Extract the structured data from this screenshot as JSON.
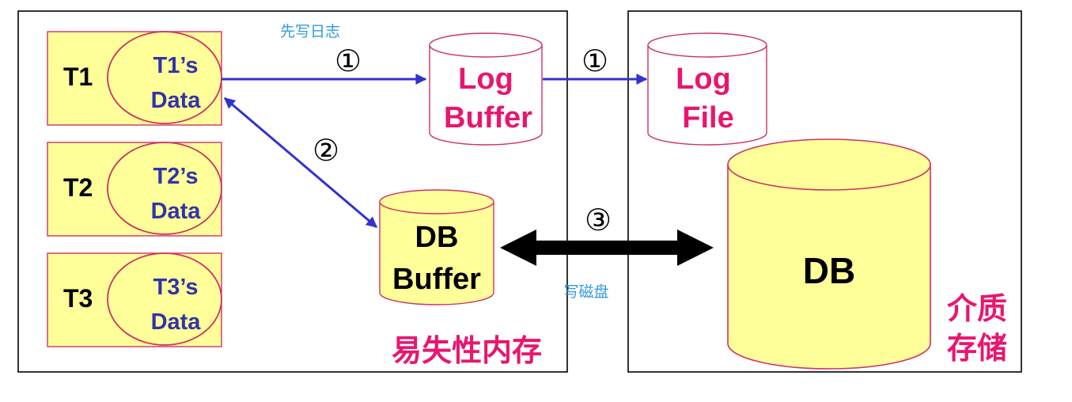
{
  "colors": {
    "background": "#ffffff",
    "frame": "#000000",
    "txn_fill": "#ffff99",
    "txn_border": "#cc3366",
    "data_text": "#3333aa",
    "cylinder_border": "#cc3366",
    "log_text": "#e8166f",
    "db_fill": "#ffff99",
    "arrow_blue": "#3333cc",
    "arrow_black": "#000000",
    "annotation_blue": "#3399dd",
    "region_label": "#e8166f",
    "dark_text": "#000000"
  },
  "volatile_memory": {
    "label": "易失性内存",
    "transactions": [
      {
        "name": "T1",
        "data_line1": "T1’s",
        "data_line2": "Data"
      },
      {
        "name": "T2",
        "data_line1": "T2’s",
        "data_line2": "Data"
      },
      {
        "name": "T3",
        "data_line1": "T3’s",
        "data_line2": "Data"
      }
    ],
    "log_buffer": {
      "line1": "Log",
      "line2": "Buffer"
    },
    "db_buffer": {
      "line1": "DB",
      "line2": "Buffer"
    }
  },
  "storage_medium": {
    "label_line1": "介质",
    "label_line2": "存储",
    "log_file": {
      "line1": "Log",
      "line2": "File"
    },
    "db": {
      "label": "DB"
    }
  },
  "steps": {
    "write_log_first": "先写日志",
    "step1": "①",
    "step1_second": "①",
    "step2": "②",
    "step3": "③",
    "write_disk": "写磁盘"
  }
}
